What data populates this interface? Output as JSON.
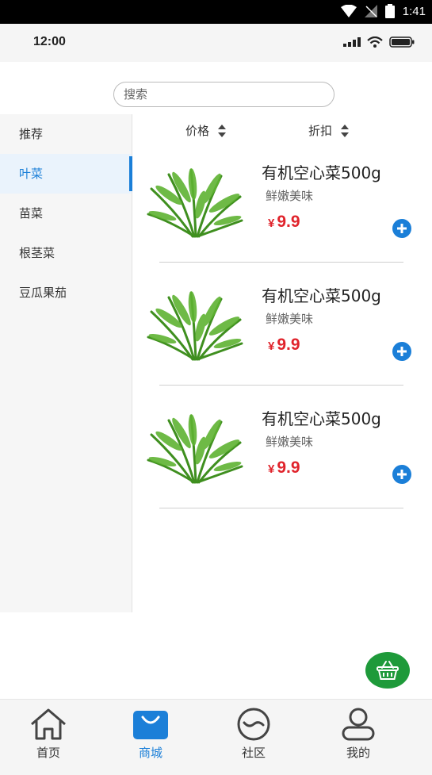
{
  "system_status": {
    "time": "1:41"
  },
  "app_status": {
    "time": "12:00"
  },
  "search": {
    "placeholder": "搜索"
  },
  "sidebar": {
    "items": [
      {
        "label": "推荐",
        "active": false
      },
      {
        "label": "叶菜",
        "active": true
      },
      {
        "label": "苗菜",
        "active": false
      },
      {
        "label": "根茎菜",
        "active": false
      },
      {
        "label": "豆瓜果茄",
        "active": false
      }
    ]
  },
  "sort": {
    "price_label": "价格",
    "discount_label": "折扣"
  },
  "products": [
    {
      "name": "有机空心菜500g",
      "desc": "鲜嫩美味",
      "currency": "¥",
      "price": "9.9"
    },
    {
      "name": "有机空心菜500g",
      "desc": "鲜嫩美味",
      "currency": "¥",
      "price": "9.9"
    },
    {
      "name": "有机空心菜500g",
      "desc": "鲜嫩美味",
      "currency": "¥",
      "price": "9.9"
    }
  ],
  "tabs": [
    {
      "label": "首页",
      "icon": "home-icon",
      "active": false
    },
    {
      "label": "商城",
      "icon": "shopping-bag-icon",
      "active": true
    },
    {
      "label": "社区",
      "icon": "community-icon",
      "active": false
    },
    {
      "label": "我的",
      "icon": "profile-icon",
      "active": false
    }
  ],
  "colors": {
    "accent": "#1b7fd8",
    "price": "#e0232b",
    "cart": "#1e9a3a"
  }
}
